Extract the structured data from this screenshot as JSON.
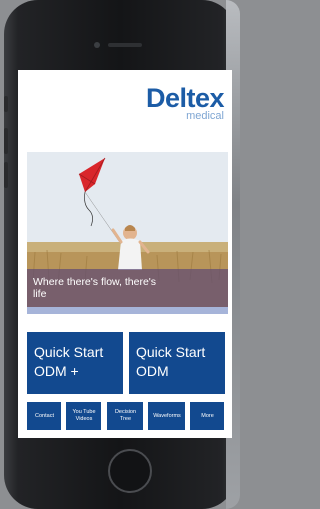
{
  "brand": {
    "name": "Deltex",
    "sub": "medical"
  },
  "hero": {
    "caption": "Where there's flow, there's life"
  },
  "tiles": {
    "big": [
      {
        "label": "Quick Start ODM +"
      },
      {
        "label": "Quick Start ODM"
      }
    ],
    "small": [
      {
        "label": "Contact"
      },
      {
        "label": "You Tube Videos"
      },
      {
        "label": "Decision Tree"
      },
      {
        "label": "Waveforms"
      },
      {
        "label": "More"
      }
    ]
  },
  "colors": {
    "brand_blue": "#1c5ca6",
    "tile_blue": "#12498f",
    "caption_overlay": "#5f4b73",
    "kite_red": "#d9262b"
  }
}
